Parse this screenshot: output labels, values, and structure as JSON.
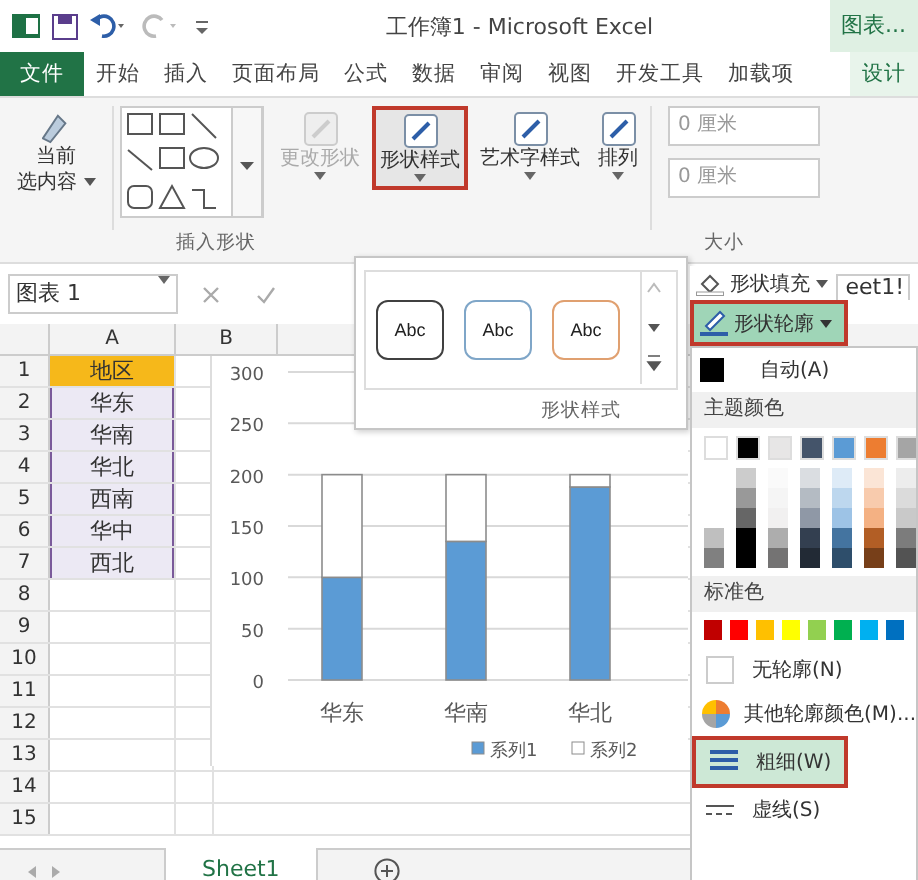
{
  "title_bar": {
    "title": "工作簿1 - Microsoft Excel",
    "context_tab": "图表..."
  },
  "ribbon_tabs": [
    {
      "label": "文件",
      "kind": "file",
      "selected": false
    },
    {
      "label": "开始",
      "kind": "tab",
      "selected": false
    },
    {
      "label": "插入",
      "kind": "tab",
      "selected": false
    },
    {
      "label": "页面布局",
      "kind": "tab",
      "selected": false
    },
    {
      "label": "公式",
      "kind": "tab",
      "selected": false
    },
    {
      "label": "数据",
      "kind": "tab",
      "selected": false
    },
    {
      "label": "审阅",
      "kind": "tab",
      "selected": false
    },
    {
      "label": "视图",
      "kind": "tab",
      "selected": false
    },
    {
      "label": "开发工具",
      "kind": "tab",
      "selected": false
    },
    {
      "label": "加载项",
      "kind": "tab",
      "selected": false
    },
    {
      "label": "设计",
      "kind": "context",
      "selected": false
    }
  ],
  "ribbon": {
    "current_selection": [
      "当前",
      "选内容"
    ],
    "buttons": [
      {
        "label": "更改形状",
        "disabled": true,
        "annotated": false
      },
      {
        "label": "形状样式",
        "disabled": false,
        "annotated": true
      },
      {
        "label": "艺术字样式",
        "disabled": false,
        "annotated": false
      },
      {
        "label": "排列",
        "disabled": false,
        "annotated": false
      }
    ],
    "size_fields": [
      {
        "value": "0 厘米"
      },
      {
        "value": "0 厘米"
      }
    ],
    "group_labels": [
      "插入形状",
      "大小"
    ]
  },
  "formula_bar": {
    "name_box": "图表 1",
    "formula": "eet1!"
  },
  "sheet": {
    "columns": [
      "A",
      "B"
    ],
    "row_numbers": [
      "1",
      "2",
      "3",
      "4",
      "5",
      "6",
      "7",
      "8",
      "9",
      "10",
      "11",
      "12",
      "13",
      "14",
      "15"
    ],
    "column_a": [
      "地区",
      "华东",
      "华南",
      "华北",
      "西南",
      "华中",
      "西北"
    ],
    "chart_data": {
      "type": "bar",
      "stacked": true,
      "grid": true,
      "legend": true,
      "categories": [
        "华东",
        "华南",
        "华北"
      ],
      "yticks": [
        0,
        50,
        100,
        150,
        200,
        250,
        300
      ],
      "ylim": [
        0,
        300
      ],
      "series": [
        {
          "name": "系列1",
          "color": "#5b9bd5",
          "values": [
            100,
            135,
            188
          ]
        },
        {
          "name": "系列2",
          "color": "#ffffff",
          "values": [
            100,
            65,
            12
          ]
        }
      ]
    }
  },
  "style_gallery": {
    "styles": [
      {
        "label": "Abc",
        "color": "#404040"
      },
      {
        "label": "Abc",
        "color": "#7fa6c8"
      },
      {
        "label": "Abc",
        "color": "#e0a070"
      }
    ],
    "group_label": "形状样式"
  },
  "outline_menu": {
    "fill_button": "形状填充",
    "outline_button": {
      "label": "形状轮廓",
      "annotated": true
    },
    "auto": "自动(A)",
    "theme_header": "主题颜色",
    "standard_header": "标准色",
    "items": [
      {
        "label": "无轮廓(N)",
        "kind": "none",
        "annotated": false
      },
      {
        "label": "其他轮廓颜色(M)...",
        "kind": "more",
        "annotated": false
      },
      {
        "label": "粗细(W)",
        "kind": "weight",
        "annotated": true
      },
      {
        "label": "虚线(S)",
        "kind": "dash",
        "annotated": false
      }
    ]
  },
  "sheet_tabs": [
    {
      "label": "Sheet1",
      "selected": true
    }
  ]
}
